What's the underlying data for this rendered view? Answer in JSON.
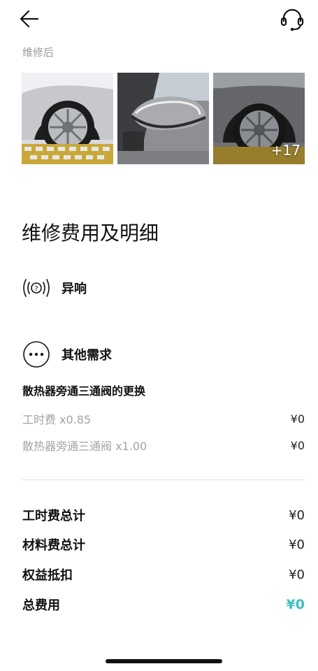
{
  "header": {
    "back_icon": "arrow-left-icon",
    "support_icon": "headset-icon"
  },
  "photos_section": {
    "label": "维修后",
    "photos": [
      {
        "subject": "wheel-tire"
      },
      {
        "subject": "side-mirror"
      },
      {
        "subject": "wheel-tire"
      }
    ],
    "more_count": "+17"
  },
  "fees": {
    "heading": "维修费用及明细",
    "issues": [
      {
        "icon": "sound-wave-icon",
        "label": "异响"
      },
      {
        "icon": "more-dots-icon",
        "label": "其他需求"
      }
    ],
    "item": {
      "title": "散热器旁通三通阀的更换",
      "lines": [
        {
          "name": "工时费 x0.85",
          "amount": "¥0"
        },
        {
          "name": "散热器旁通三通阀 x1.00",
          "amount": "¥0"
        }
      ]
    },
    "totals": [
      {
        "name": "工时费总计",
        "amount": "¥0"
      },
      {
        "name": "材料费总计",
        "amount": "¥0"
      },
      {
        "name": "权益抵扣",
        "amount": "¥0"
      },
      {
        "name": "总费用",
        "amount": "¥0"
      }
    ]
  },
  "colors": {
    "accent": "#3fbfbd",
    "muted_text": "#a3a3a3",
    "divider": "#e2e2e2"
  }
}
